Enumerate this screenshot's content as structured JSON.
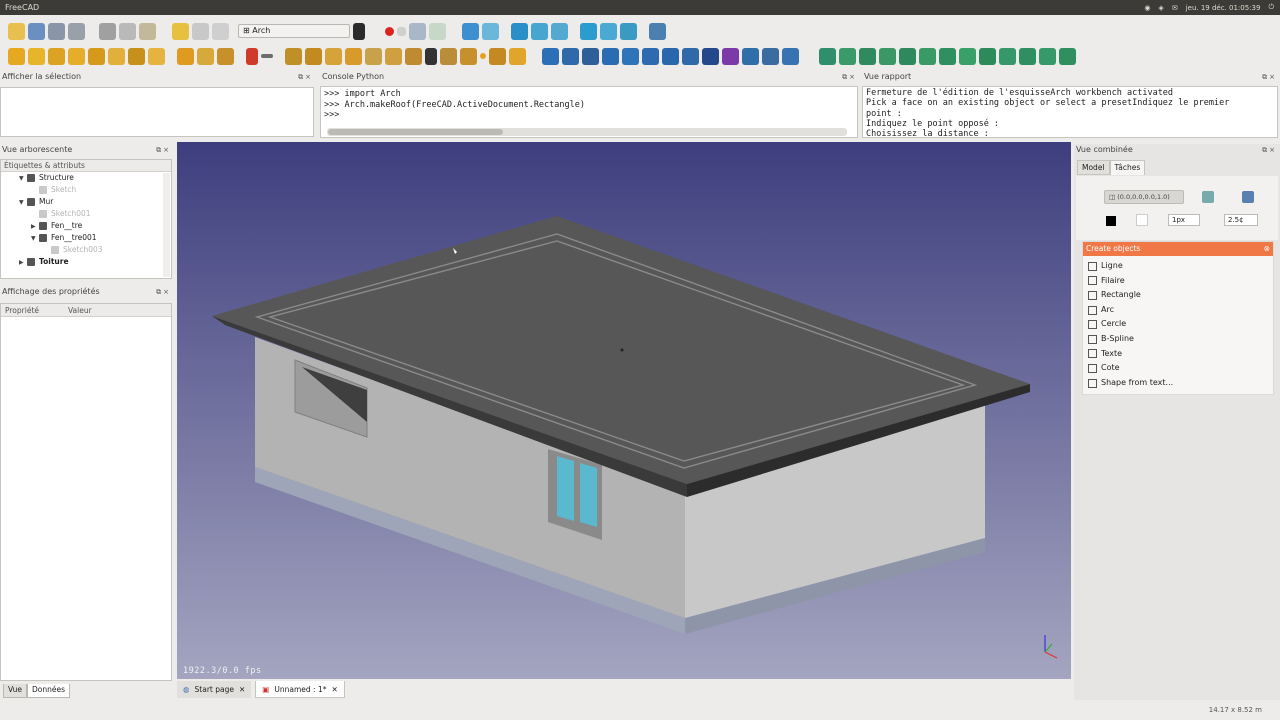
{
  "window": {
    "title": "FreeCAD",
    "clock": "jeu. 19 déc. 01:05:39"
  },
  "toolbar": {
    "workbench": "Arch"
  },
  "selection_panel": {
    "title": "Afficher la sélection"
  },
  "python_console": {
    "title": "Console Python",
    "lines": [
      ">>> import Arch",
      ">>> Arch.makeRoof(FreeCAD.ActiveDocument.Rectangle)",
      ">>> "
    ]
  },
  "report_view": {
    "title": "Vue rapport",
    "lines": [
      "Fermeture de l'édition de l'esquisseArch workbench activated",
      "Pick a face on an existing object or select a presetIndiquez le premier",
      "point :",
      "Indiquez le point opposé :",
      "Choisissez la distance :"
    ]
  },
  "tree_panel": {
    "title": "Vue arborescente",
    "header": "Étiquettes & attributs",
    "items": [
      {
        "label": "Structure",
        "indent": 1,
        "expand": "▼",
        "dim": false,
        "bold": false
      },
      {
        "label": "Sketch",
        "indent": 2,
        "expand": "",
        "dim": true,
        "bold": false
      },
      {
        "label": "Mur",
        "indent": 1,
        "expand": "▼",
        "dim": false,
        "bold": false
      },
      {
        "label": "Sketch001",
        "indent": 2,
        "expand": "",
        "dim": true,
        "bold": false
      },
      {
        "label": "Fen__tre",
        "indent": 2,
        "expand": "▶",
        "dim": false,
        "bold": false
      },
      {
        "label": "Fen__tre001",
        "indent": 2,
        "expand": "▼",
        "dim": false,
        "bold": false
      },
      {
        "label": "Sketch003",
        "indent": 3,
        "expand": "",
        "dim": true,
        "bold": false
      },
      {
        "label": "Toiture",
        "indent": 1,
        "expand": "▶",
        "dim": false,
        "bold": true
      }
    ]
  },
  "properties_panel": {
    "title": "Affichage des propriétés",
    "col_property": "Propriété",
    "col_value": "Valeur",
    "tab_view": "Vue",
    "tab_data": "Données"
  },
  "viewport": {
    "fps": "1922.3/0.0 fps",
    "bg_top": "#3e3e7e",
    "bg_bottom": "#a4a5c0"
  },
  "doc_tabs": [
    {
      "label": "Start page"
    },
    {
      "label": "Unnamed : 1*"
    }
  ],
  "combo": {
    "title": "Vue combinée",
    "tab_model": "Model",
    "tab_tasks": "Tâches",
    "coords": "(0.0,0.0,0.0,1.0)",
    "linewidth": "1px",
    "fontsize": "2.5¢",
    "create_title": "Create objects",
    "accent": "#f07746",
    "items": [
      {
        "label": "Ligne"
      },
      {
        "label": "Filaire"
      },
      {
        "label": "Rectangle"
      },
      {
        "label": "Arc"
      },
      {
        "label": "Cercle"
      },
      {
        "label": "B-Spline"
      },
      {
        "label": "Texte"
      },
      {
        "label": "Cote"
      },
      {
        "label": "Shape from text..."
      }
    ]
  },
  "status": {
    "dimensions": "14.17 x 8.52 m"
  }
}
